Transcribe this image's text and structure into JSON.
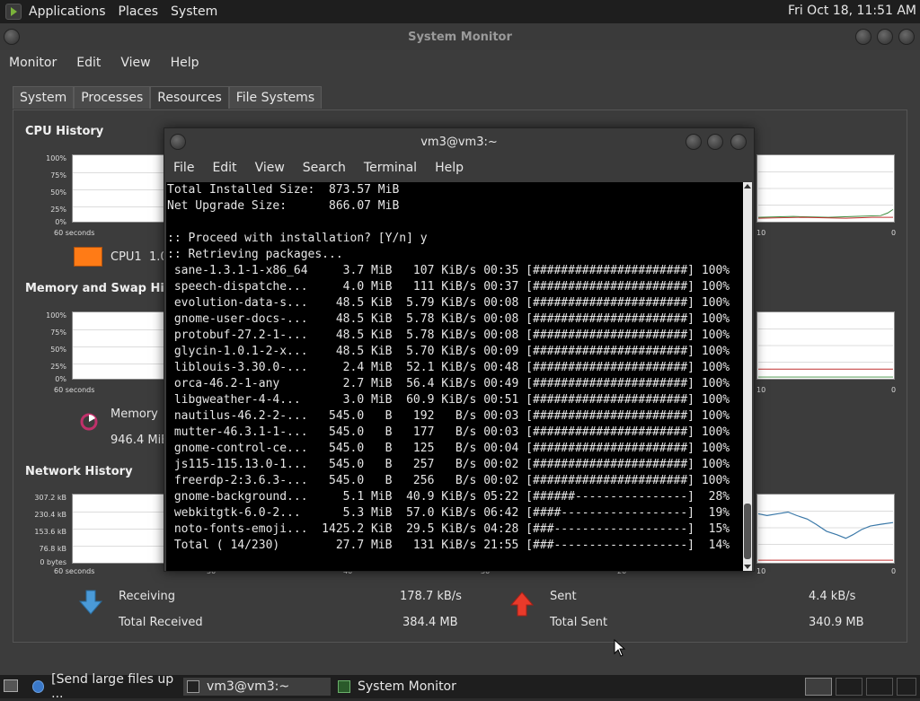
{
  "top_panel": {
    "menu": [
      "Applications",
      "Places",
      "System"
    ],
    "clock": "Fri Oct 18, 11:51 AM"
  },
  "sysmon": {
    "title": "System Monitor",
    "menu": [
      "Monitor",
      "Edit",
      "View",
      "Help"
    ],
    "tabs": [
      "System",
      "Processes",
      "Resources",
      "File Systems"
    ],
    "active_tab": "Resources",
    "cpu": {
      "title": "CPU History",
      "y_ticks": [
        "100%",
        "75%",
        "50%",
        "25%",
        "0%"
      ],
      "x_left": "60 seconds",
      "x_right": "0",
      "x_mid_right": "10",
      "legend_label": "CPU1",
      "legend_value": "1.0",
      "legend_color": "#ff7b16"
    },
    "memory": {
      "title": "Memory and Swap History",
      "y_ticks": [
        "100%",
        "75%",
        "50%",
        "25%",
        "0%"
      ],
      "x_left": "60 seconds",
      "x_right": "0",
      "x_mid_right": "10",
      "legend_label": "Memory",
      "legend_value": "946.4 MiB"
    },
    "network": {
      "title": "Network History",
      "y_ticks": [
        "307.2 kB",
        "230.4 kB",
        "153.6 kB",
        "76.8 kB",
        "0 bytes"
      ],
      "x_left": "60 seconds",
      "x_ticks": [
        "50",
        "40",
        "30",
        "20",
        "10",
        "0"
      ],
      "receiving_label": "Receiving",
      "receiving_value": "178.7 kB/s",
      "total_received_label": "Total Received",
      "total_received_value": "384.4 MB",
      "sent_label": "Sent",
      "sent_value": "4.4 kB/s",
      "total_sent_label": "Total Sent",
      "total_sent_value": "340.9 MB"
    }
  },
  "terminal": {
    "title": "vm3@vm3:~",
    "menu": [
      "File",
      "Edit",
      "View",
      "Search",
      "Terminal",
      "Help"
    ],
    "lines": [
      "Total Installed Size:  873.57 MiB",
      "Net Upgrade Size:      866.07 MiB",
      "",
      ":: Proceed with installation? [Y/n] y",
      ":: Retrieving packages...",
      " sane-1.3.1-1-x86_64     3.7 MiB   107 KiB/s 00:35 [######################] 100%",
      " speech-dispatche...     4.0 MiB   111 KiB/s 00:37 [######################] 100%",
      " evolution-data-s...    48.5 KiB  5.79 KiB/s 00:08 [######################] 100%",
      " gnome-user-docs-...    48.5 KiB  5.78 KiB/s 00:08 [######################] 100%",
      " protobuf-27.2-1-...    48.5 KiB  5.78 KiB/s 00:08 [######################] 100%",
      " glycin-1.0.1-2-x...    48.5 KiB  5.70 KiB/s 00:09 [######################] 100%",
      " liblouis-3.30.0-...     2.4 MiB  52.1 KiB/s 00:48 [######################] 100%",
      " orca-46.2-1-any         2.7 MiB  56.4 KiB/s 00:49 [######################] 100%",
      " libgweather-4-4...      3.0 MiB  60.9 KiB/s 00:51 [######################] 100%",
      " nautilus-46.2-2-...   545.0   B   192   B/s 00:03 [######################] 100%",
      " mutter-46.3.1-1-...   545.0   B   177   B/s 00:03 [######################] 100%",
      " gnome-control-ce...   545.0   B   125   B/s 00:04 [######################] 100%",
      " js115-115.13.0-1...   545.0   B   257   B/s 00:02 [######################] 100%",
      " freerdp-2:3.6.3-...   545.0   B   256   B/s 00:02 [######################] 100%",
      " gnome-background...     5.1 MiB  40.9 KiB/s 05:22 [######----------------]  28%",
      " webkitgtk-6.0-2...      5.3 MiB  57.0 KiB/s 06:42 [####------------------]  19%",
      " noto-fonts-emoji...  1425.2 KiB  29.5 KiB/s 04:28 [###-------------------]  15%",
      " Total ( 14/230)        27.7 MiB   131 KiB/s 21:55 [###-------------------]  14%"
    ]
  },
  "taskbar": {
    "items": [
      "[Send large files up ...",
      "vm3@vm3:~",
      "System Monitor"
    ]
  }
}
